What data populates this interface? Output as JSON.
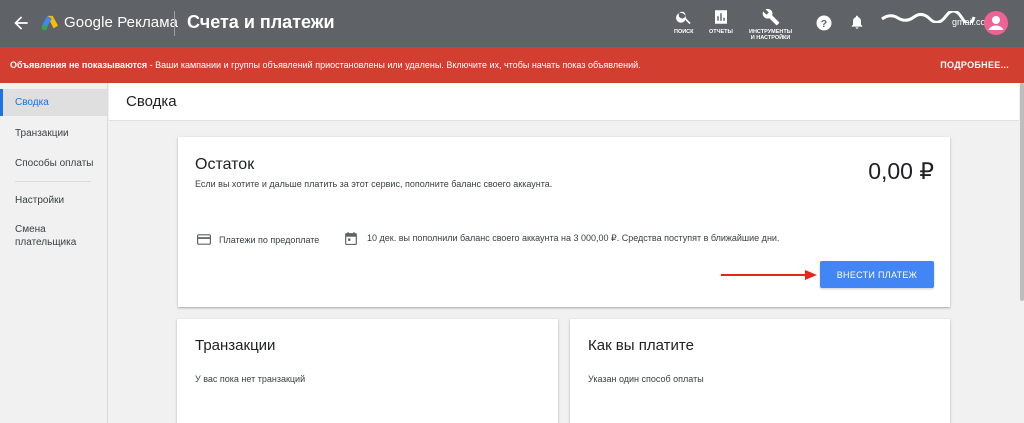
{
  "header": {
    "product_name": "Google Реклама",
    "page_heading": "Счета и платежи",
    "tools": [
      {
        "icon": "search-icon",
        "label": "ПОИСК"
      },
      {
        "icon": "bar-chart-icon",
        "label": "ОТЧЕТЫ"
      },
      {
        "icon": "wrench-icon",
        "label": "ИНСТРУМЕНТЫ\nИ НАСТРОЙКИ"
      }
    ],
    "account_email": "gmail.com",
    "colors": {
      "bar": "#5f6368",
      "avatar": "#ef6294"
    }
  },
  "alert": {
    "bold_text": "Объявления не показываются",
    "text": " - Ваши кампании и группы объявлений приостановлены или удалены. Включите их, чтобы начать показ объявлений.",
    "more_label": "ПОДРОБНЕЕ...",
    "color": "#d23f31"
  },
  "sidebar": {
    "items": [
      {
        "label": "Сводка",
        "active": true
      },
      {
        "label": "Транзакции"
      },
      {
        "label": "Способы оплаты"
      },
      {
        "label": "Настройки"
      },
      {
        "label": "Смена плательщика"
      }
    ],
    "accent": "#1a73e8"
  },
  "main": {
    "title": "Сводка",
    "balance_card": {
      "title": "Остаток",
      "subtitle": "Если вы хотите и дальше платить за этот сервис, пополните баланс своего аккаунта.",
      "amount": "0,00 ₽",
      "payment_type": "Платежи по предоплате",
      "payment_note": "10 дек. вы пополнили баланс своего аккаунта на 3 000,00 ₽. Средства поступят в ближайшие дни.",
      "pay_button_label": "ВНЕСТИ ПЛАТЕЖ",
      "button_color": "#4285f4"
    },
    "transactions_card": {
      "title": "Транзакции",
      "text": "У вас пока нет транзакций"
    },
    "how_you_pay_card": {
      "title": "Как вы платите",
      "text": "Указан один способ оплаты"
    }
  }
}
